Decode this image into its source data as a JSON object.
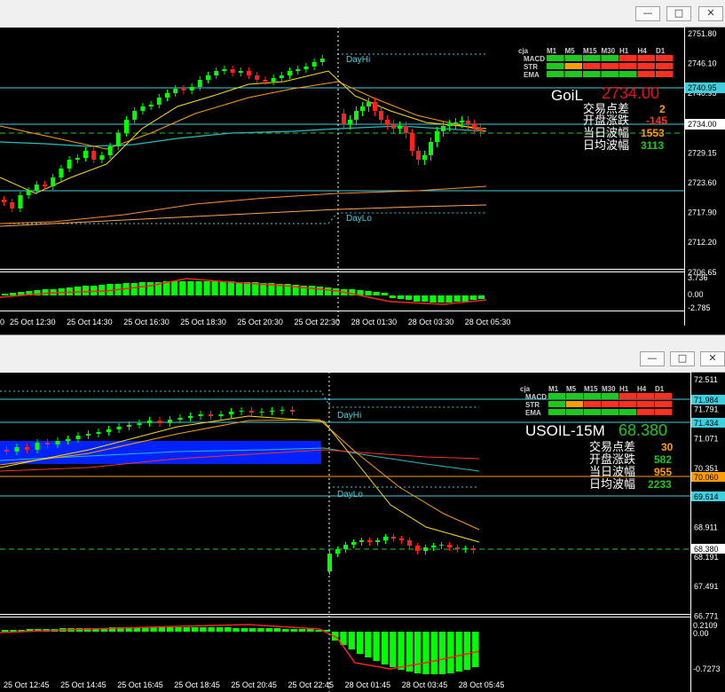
{
  "colors": {
    "bull": "#00ff00",
    "bear": "#ff0000",
    "cyan": "#3fd0e0",
    "orange": "#ff9d00",
    "yellow": "#ffe000",
    "blue": "#0000ff"
  },
  "top": {
    "controls": [
      "minimize-icon",
      "maximize-icon",
      "close-icon"
    ],
    "price_axis": [
      "2751.80",
      "2746.10",
      "2740.95",
      "2734.00",
      "2729.15",
      "2723.60",
      "2717.90",
      "2712.20",
      "2706.65"
    ],
    "price_tags": {
      "upper": "2740.95",
      "current": "2734.00"
    },
    "overlap_labels": [
      "2734.00",
      "2729.15"
    ],
    "osc_axis": [
      "3.736",
      "0.00",
      "-2.785"
    ],
    "time_axis": [
      "25 Oct 12:30",
      "25 Oct 14:30",
      "25 Oct 16:30",
      "25 Oct 18:30",
      "25 Oct 20:30",
      "25 Oct 22:30",
      "28 Oct 01:30",
      "28 Oct 03:30",
      "28 Oct 05:30"
    ],
    "time_stub": "0",
    "day_hi": "DayHi",
    "day_lo": "DayLo",
    "matrix": {
      "title": "cja",
      "cols": [
        "M1",
        "M5",
        "M15",
        "M30",
        "H1",
        "H4",
        "D1"
      ],
      "rows": [
        "MACD",
        "STR",
        "EMA"
      ]
    },
    "info": {
      "symbol": "GoiL",
      "price": "2734.00",
      "rows": [
        {
          "label": "交易点差",
          "value": "2"
        },
        {
          "label": "开盘涨跌",
          "value": "-145"
        },
        {
          "label": "当日波幅",
          "value": "1553"
        },
        {
          "label": "日均波幅",
          "value": "3113"
        }
      ]
    }
  },
  "bottom": {
    "controls": [
      "minimize-icon",
      "maximize-icon",
      "close-icon"
    ],
    "price_axis": [
      "72.511",
      "71.791",
      "71.071",
      "70.351",
      "69.631",
      "68.911",
      "68.191",
      "67.491",
      "66.771"
    ],
    "price_tags": {
      "t1": "71.984",
      "t2": "71.434",
      "t3": "70.060",
      "t4": "69.614",
      "t5": "68.380"
    },
    "osc_axis": [
      "0.2109",
      "0.00",
      "-0.7273"
    ],
    "time_axis": [
      "25 Oct 12:45",
      "25 Oct 14:45",
      "25 Oct 16:45",
      "25 Oct 18:45",
      "25 Oct 20:45",
      "25 Oct 22:45",
      "28 Oct 01:45",
      "28 Oct 03:45",
      "28 Oct 05:45"
    ],
    "day_hi": "DayHi",
    "day_lo": "DayLo",
    "matrix": {
      "title": "cja",
      "cols": [
        "M1",
        "M5",
        "M15",
        "M30",
        "H1",
        "H4",
        "D1"
      ],
      "rows": [
        "MACD",
        "STR",
        "EMA"
      ]
    },
    "info": {
      "symbol": "USOIL-15M",
      "price": "68.380",
      "rows": [
        {
          "label": "交易点差",
          "value": "30"
        },
        {
          "label": "开盘涨跌",
          "value": "582"
        },
        {
          "label": "当日波幅",
          "value": "955"
        },
        {
          "label": "日均波幅",
          "value": "2233"
        }
      ]
    }
  }
}
